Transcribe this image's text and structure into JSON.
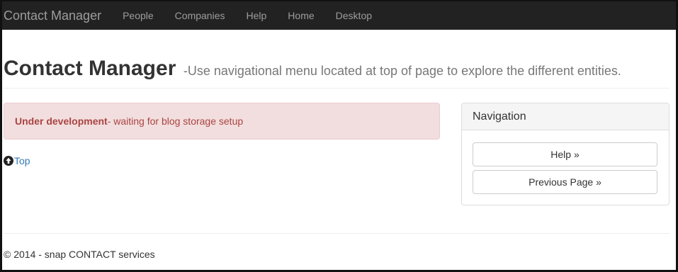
{
  "navbar": {
    "brand": "Contact Manager",
    "links": [
      "People",
      "Companies",
      "Help",
      "Home",
      "Desktop"
    ]
  },
  "header": {
    "title": "Contact Manager",
    "subtitle": "-Use navigational menu located at top of page to explore the different entities."
  },
  "alert": {
    "strong": "Under development",
    "message": "- waiting for blog storage setup"
  },
  "top_link": {
    "icon": "circle-arrow-up-icon",
    "label": "Top"
  },
  "navigation_panel": {
    "heading": "Navigation",
    "buttons": [
      "Help »",
      "Previous Page »"
    ]
  },
  "footer": {
    "text": "© 2014 - snap CONTACT services"
  },
  "colors": {
    "navbar_bg": "#222222",
    "nav_text": "#9d9d9d",
    "alert_bg": "#f2dede",
    "alert_text": "#a94442",
    "link": "#337ab7"
  }
}
